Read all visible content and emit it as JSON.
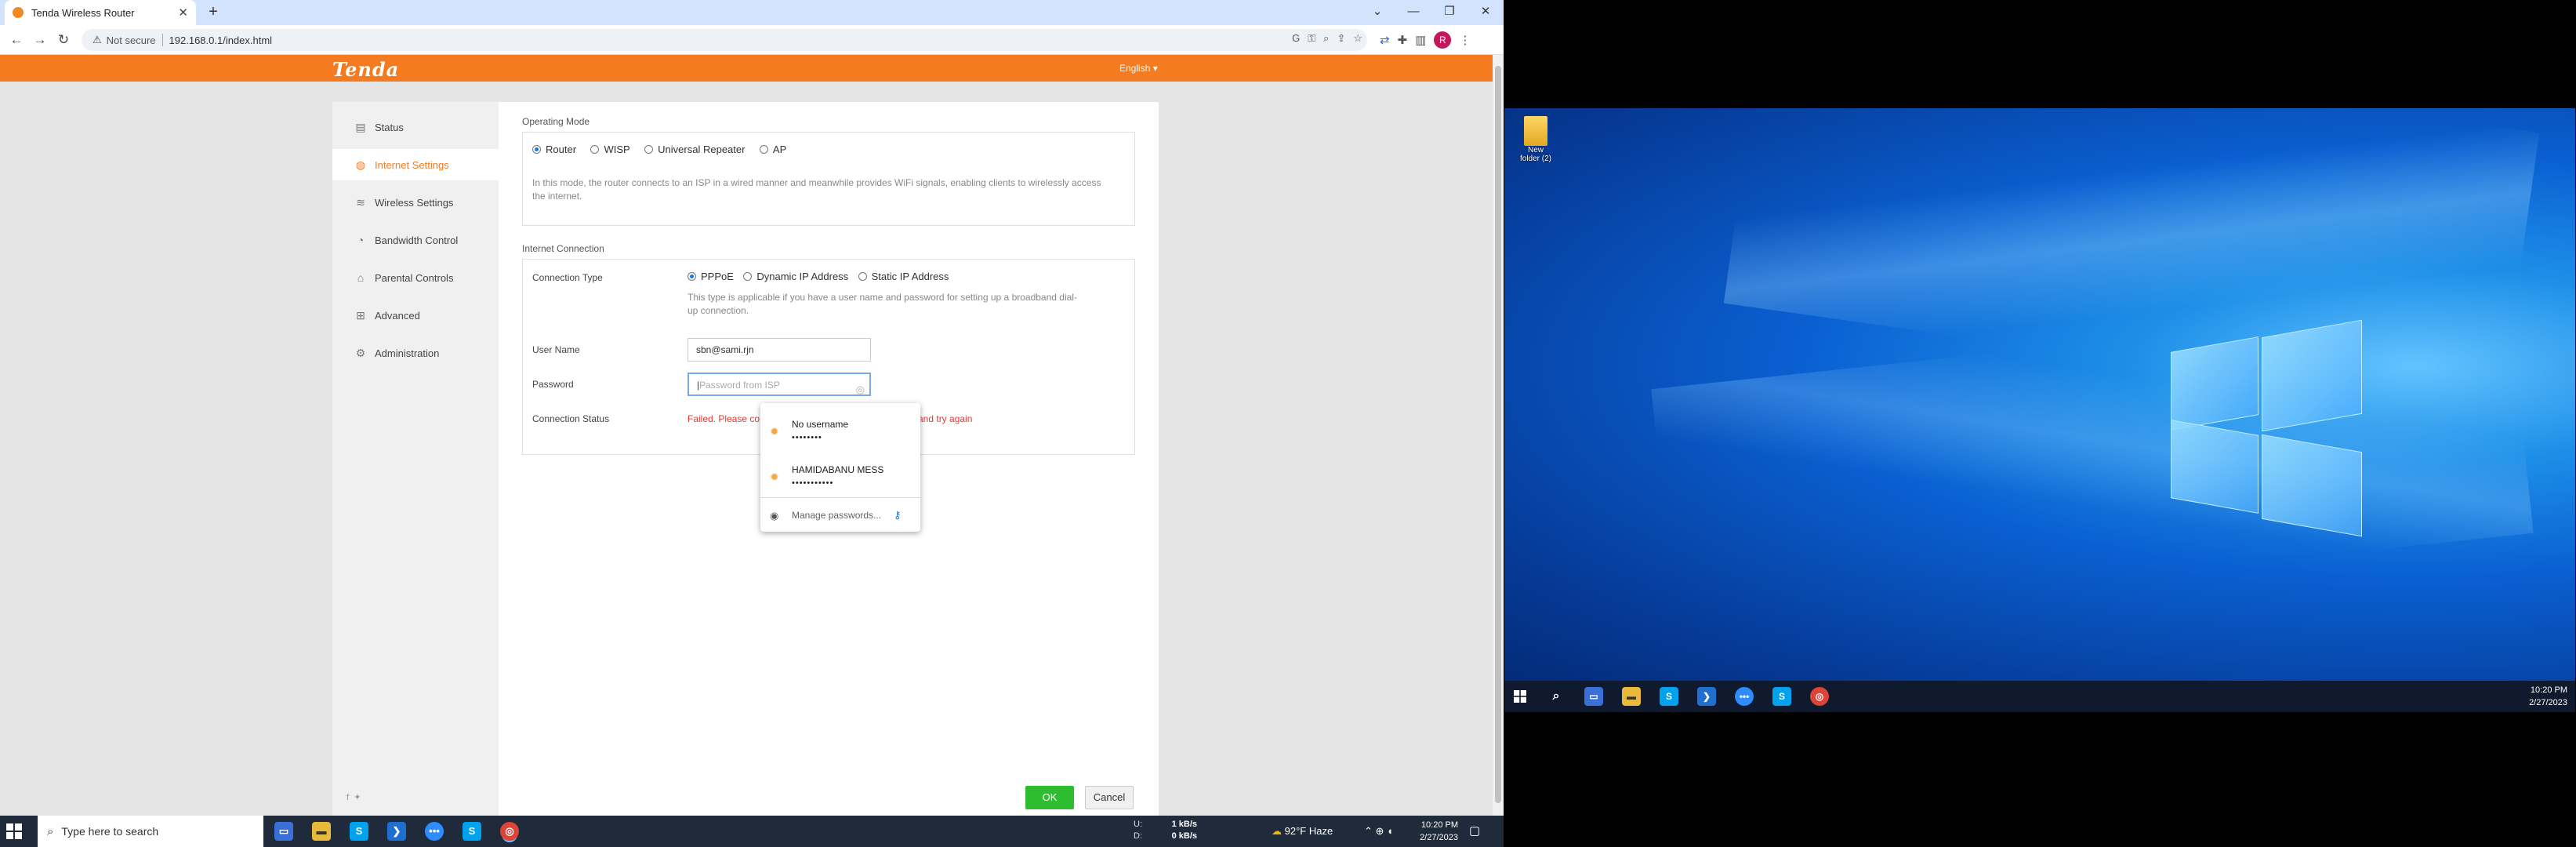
{
  "browser": {
    "tab_title": "Tenda Wireless Router",
    "url": "192.168.0.1/index.html",
    "security_label": "Not secure",
    "profile_initial": "R"
  },
  "router": {
    "brand": "Tenda",
    "language": "English",
    "menu": [
      {
        "label": "Status",
        "icon": "status-icon"
      },
      {
        "label": "Internet Settings",
        "icon": "globe-icon"
      },
      {
        "label": "Wireless Settings",
        "icon": "wifi-icon"
      },
      {
        "label": "Bandwidth Control",
        "icon": "gauge-icon"
      },
      {
        "label": "Parental Controls",
        "icon": "parental-icon"
      },
      {
        "label": "Advanced",
        "icon": "grid-icon"
      },
      {
        "label": "Administration",
        "icon": "gear-icon"
      }
    ],
    "operating_mode": {
      "title": "Operating Mode",
      "options": [
        "Router",
        "WISP",
        "Universal Repeater",
        "AP"
      ],
      "selected": "Router",
      "description": "In this mode, the router connects to an ISP in a wired manner and meanwhile provides WiFi signals, enabling clients to wirelessly access the internet."
    },
    "internet_connection": {
      "title": "Internet Connection",
      "connection_type_label": "Connection Type",
      "types": [
        "PPPoE",
        "Dynamic IP Address",
        "Static IP Address"
      ],
      "selected": "PPPoE",
      "type_hint": "This type is applicable if you have a user name and password for setting up a broadband dial-up connection.",
      "username_label": "User Name",
      "username_value": "sbn@sami.rjn",
      "password_label": "Password",
      "password_placeholder": "Password from ISP",
      "status_label": "Connection Status",
      "status_text_left": "Failed. Please co",
      "status_text_right": "and try again"
    },
    "ok_label": "OK",
    "cancel_label": "Cancel"
  },
  "password_popup": {
    "entries": [
      {
        "username": "No username",
        "password_mask": "••••••••"
      },
      {
        "username": "HAMIDABANU MESS",
        "password_mask": "•••••••••••"
      }
    ],
    "manage_label": "Manage passwords..."
  },
  "taskbar": {
    "search_placeholder": "Type here to search",
    "upload_label": "U:",
    "upload_value": "1 kB/s",
    "download_label": "D:",
    "download_value": "0 kB/s",
    "weather": "92°F  Haze",
    "time": "10:20 PM",
    "date": "2/27/2023"
  },
  "desktop2": {
    "folder_label": "New folder (2)",
    "time": "10:20 PM",
    "date": "2/27/2023"
  }
}
